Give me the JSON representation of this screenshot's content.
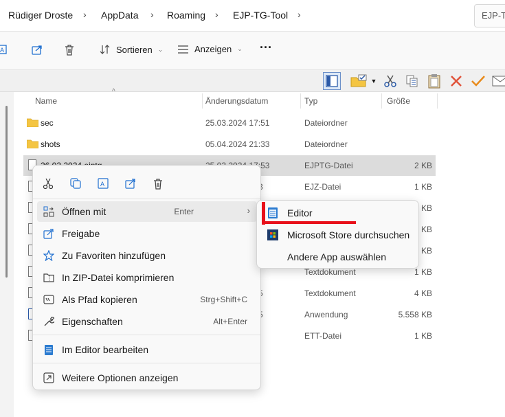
{
  "breadcrumb": {
    "items": [
      "Rüdiger Droste",
      "AppData",
      "Roaming",
      "EJP-TG-Tool"
    ],
    "search_text": "EJP-TG"
  },
  "commandbar": {
    "sort_label": "Sortieren",
    "view_label": "Anzeigen",
    "more_label": "···"
  },
  "columns": {
    "name": "Name",
    "date": "Änderungsdatum",
    "type": "Typ",
    "size": "Größe"
  },
  "files": [
    {
      "name": "sec",
      "date": "25.03.2024 17:51",
      "type": "Dateiordner",
      "size": "",
      "kind": "folder"
    },
    {
      "name": "shots",
      "date": "05.04.2024 21:33",
      "type": "Dateiordner",
      "size": "",
      "kind": "folder"
    },
    {
      "name": "26.03.2024.ejptg",
      "date": "25.03.2024 17:53",
      "type": "EJPTG-Datei",
      "size": "2 KB",
      "kind": "file"
    },
    {
      "name": "",
      "date": "3",
      "type": "EJZ-Datei",
      "size": "1 KB",
      "kind": "file"
    },
    {
      "name": "",
      "date": "",
      "type": "",
      "size": "3 KB",
      "kind": "file"
    },
    {
      "name": "",
      "date": "",
      "type": "",
      "size": "5 KB",
      "kind": "file"
    },
    {
      "name": "",
      "date": "",
      "type": "",
      "size": "3 KB",
      "kind": "file"
    },
    {
      "name": "",
      "date": "",
      "type": "Textdokument",
      "size": "1 KB",
      "kind": "file"
    },
    {
      "name": "",
      "date": "5",
      "type": "Textdokument",
      "size": "4 KB",
      "kind": "file"
    },
    {
      "name": "",
      "date": "5",
      "type": "Anwendung",
      "size": "5.558 KB",
      "kind": "file"
    },
    {
      "name": "",
      "date": "",
      "type": "ETT-Datei",
      "size": "1 KB",
      "kind": "file"
    }
  ],
  "context_menu": {
    "items": [
      {
        "label": "Öffnen mit",
        "shortcut": "Enter",
        "arrow": "›"
      },
      {
        "label": "Freigabe",
        "shortcut": ""
      },
      {
        "label": "Zu Favoriten hinzufügen",
        "shortcut": ""
      },
      {
        "label": "In ZIP-Datei komprimieren",
        "shortcut": ""
      },
      {
        "label": "Als Pfad kopieren",
        "shortcut": "Strg+Shift+C"
      },
      {
        "label": "Eigenschaften",
        "shortcut": "Alt+Enter"
      },
      {
        "label": "Im Editor bearbeiten",
        "shortcut": ""
      },
      {
        "label": "Weitere Optionen anzeigen",
        "shortcut": ""
      }
    ]
  },
  "submenu": {
    "items": [
      {
        "label": "Editor"
      },
      {
        "label": "Microsoft Store durchsuchen"
      },
      {
        "label": "Andere App auswählen"
      }
    ]
  },
  "colors": {
    "annotation_red": "#e8101a",
    "folder_yellow": "#f4c542",
    "accent_blue": "#1f6fd0"
  }
}
